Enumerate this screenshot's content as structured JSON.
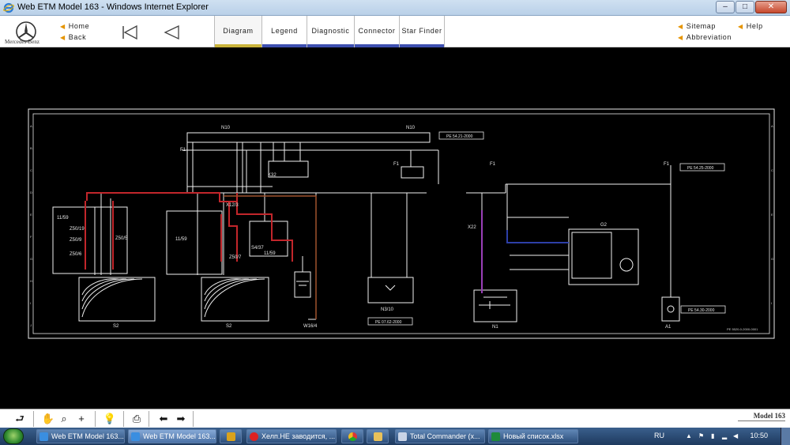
{
  "window": {
    "title": "Web ETM Model 163 - Windows Internet Explorer"
  },
  "brand": {
    "logo_text": "Mercedes-Benz"
  },
  "nav": {
    "home": "Home",
    "back": "Back",
    "tabs": [
      "Diagram",
      "Legend",
      "Diagnostic",
      "Connector",
      "Star Finder"
    ],
    "active_tab": "Diagram",
    "sitemap": "Sitemap",
    "help": "Help",
    "abbreviation": "Abbreviation"
  },
  "diagram": {
    "labels": {
      "n10_a": "N10",
      "n10_b": "N10",
      "f1_a": "F1",
      "f1_b": "F1",
      "f1_c": "F1",
      "f1_d": "F1",
      "pe_5421": "PE 54.21-2000",
      "pe_5425": "PE 54.25-2000",
      "pe_5430": "PE 54.30-2000",
      "pe_0762": "PE 07.62-2000",
      "z50_19": "Z50/19",
      "z50_5": "Z50/5",
      "z50_9": "Z50/9",
      "z50_6": "Z50/6",
      "z50_7": "Z50/7",
      "x12_3": "X12/3",
      "x22": "X22",
      "w16_4": "W16/4",
      "k32": "K32",
      "s4_37": "S4/37",
      "s2_a": "S2",
      "s2_b": "S2",
      "n3_10": "N3/10",
      "n1": "N1",
      "g2": "G2",
      "a1": "A1",
      "l1_59a": "11/59",
      "l1_59b": "11/59",
      "l1_59c": "11/59",
      "footer_code": "PE 5520-0-2000-0001"
    }
  },
  "toolbar": {
    "model_label": "Model 163"
  },
  "taskbar": {
    "tasks": [
      "Web ETM Model 163...",
      "Web ETM Model 163...",
      "",
      "Хелп.НЕ заводится, ...",
      "",
      "",
      "Total Commander (x...",
      "Новый список.xlsx"
    ],
    "lang": "RU",
    "clock": "10:50"
  },
  "colors": {
    "wire_red": "#c2262b",
    "wire_purple": "#9a3fb8",
    "wire_blue": "#2d3fa8",
    "wire_brown": "#a0522d",
    "nav_tab_bar": "#3d4fb0",
    "active_tab_bar": "#c9b33a"
  }
}
